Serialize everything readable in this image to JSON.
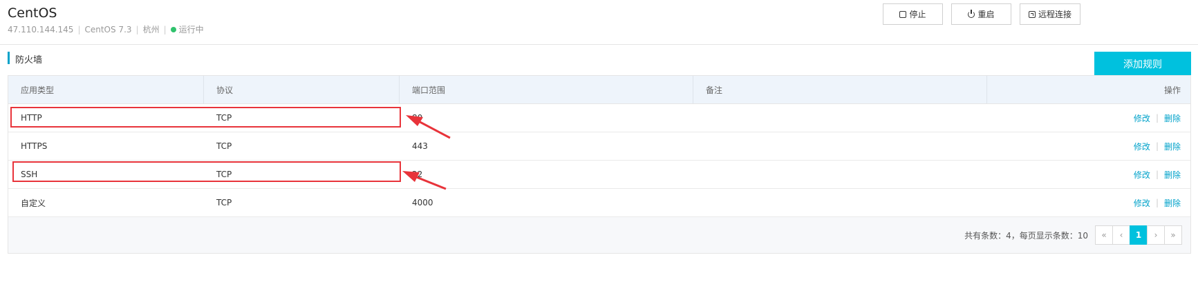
{
  "header": {
    "title": "CentOS",
    "ip": "47.110.144.145",
    "os": "CentOS 7.3",
    "region": "杭州",
    "status": "运行中",
    "buttons": {
      "stop": "停止",
      "restart": "重启",
      "remote": "远程连接"
    }
  },
  "section": {
    "title": "防火墙",
    "add_button": "添加规则"
  },
  "table": {
    "columns": [
      "应用类型",
      "协议",
      "端口范围",
      "备注",
      "操作"
    ],
    "rows": [
      {
        "type": "HTTP",
        "protocol": "TCP",
        "port": "80",
        "note": "",
        "edit": "修改",
        "delete": "删除"
      },
      {
        "type": "HTTPS",
        "protocol": "TCP",
        "port": "443",
        "note": "",
        "edit": "修改",
        "delete": "删除"
      },
      {
        "type": "SSH",
        "protocol": "TCP",
        "port": "22",
        "note": "",
        "edit": "修改",
        "delete": "删除"
      },
      {
        "type": "自定义",
        "protocol": "TCP",
        "port": "4000",
        "note": "",
        "edit": "修改",
        "delete": "删除"
      }
    ]
  },
  "pagination": {
    "total_text": "共有条数：4，每页显示条数：10",
    "first": "«",
    "prev": "‹",
    "current": "1",
    "next": "›",
    "last": "»"
  },
  "colors": {
    "accent": "#00c1de",
    "link": "#00a2ca",
    "annotation": "#e8333a",
    "status_running": "#2fc26d"
  }
}
